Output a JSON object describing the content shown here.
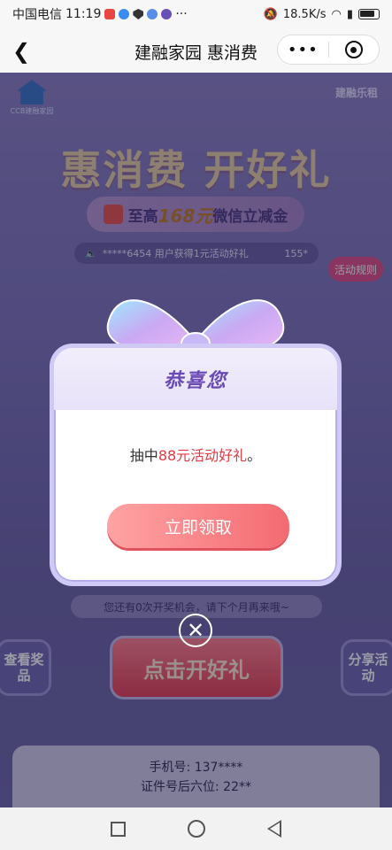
{
  "status_bar": {
    "carrier": "中国电信",
    "time": "11:19",
    "network_speed": "18.5K/s",
    "dots": "···"
  },
  "nav": {
    "title": "建融家园 惠消费",
    "more_label": "•••"
  },
  "background": {
    "logo_left_text": "CCB建融家园",
    "logo_right_text": "建融乐租",
    "hero_title": "惠消费 开好礼",
    "subtitle_prefix": "至高",
    "subtitle_amount": "168元",
    "subtitle_suffix": "微信立减金",
    "marquee_text": "*****6454 用户获得1元活动好礼",
    "marquee_count": "155*",
    "rules_label": "活动规则",
    "chance_text": "您还有0次开奖机会，请下个月再来哦~",
    "left_button": "查看奖品",
    "right_button": "分享活动",
    "main_button": "点击开好礼",
    "info_line1": "手机号: 137****",
    "info_line2": "证件号后六位: 22**"
  },
  "modal": {
    "title": "恭喜您",
    "message_prefix": "抽中",
    "message_highlight": "88元活动好礼",
    "message_suffix": "。",
    "claim_button": "立即领取",
    "close_symbol": "✕"
  },
  "colors": {
    "accent": "#e23b43",
    "title_purple": "#6a4bb5",
    "button_pink": "#f46b72"
  }
}
